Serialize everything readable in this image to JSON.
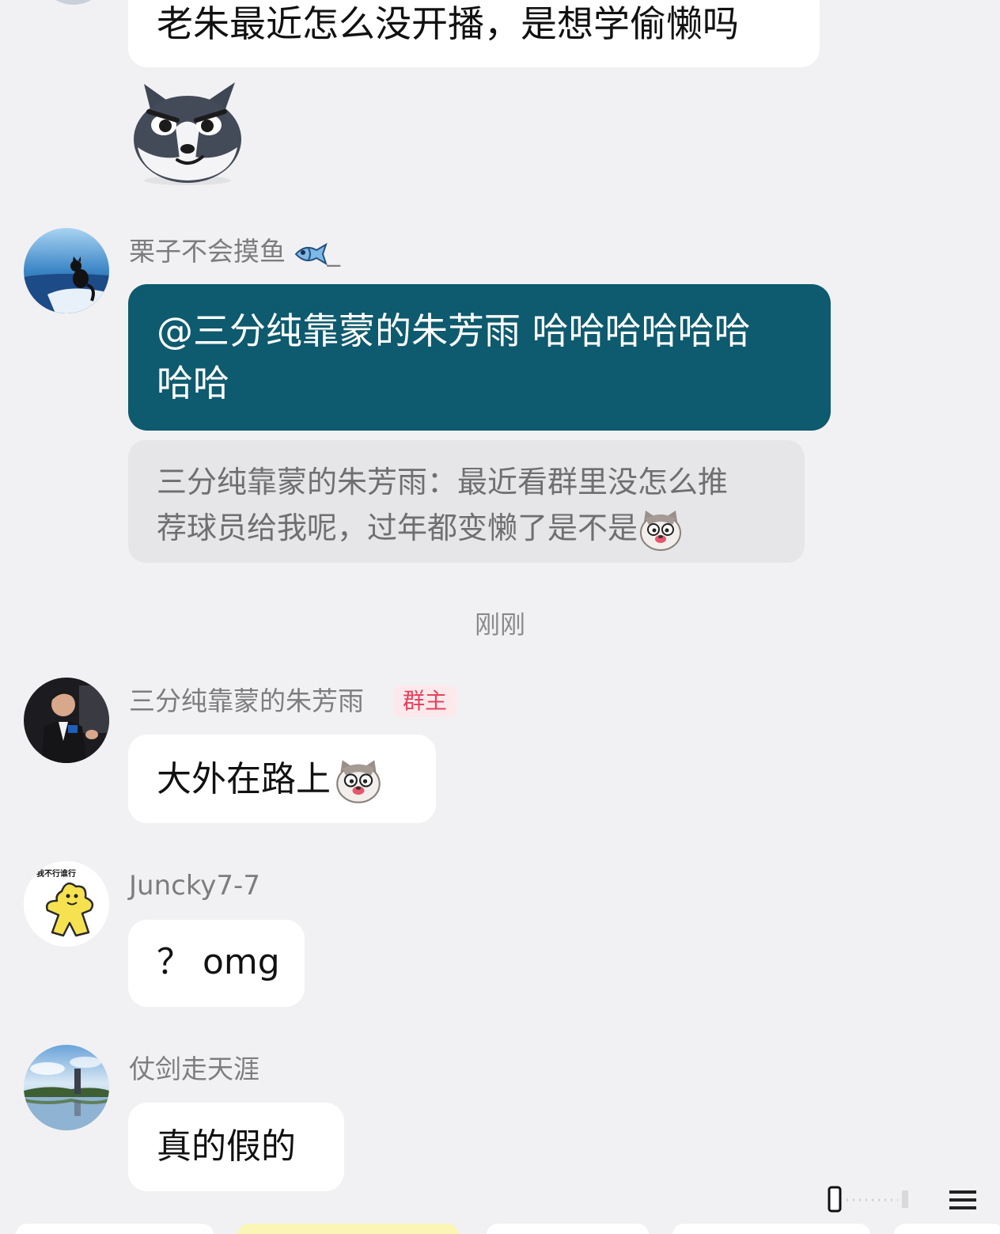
{
  "messages": {
    "m1": {
      "text": "老朱最近怎么没开播，是想学偷懒吗"
    },
    "m2": {
      "nickname": "栗子不会摸鱼",
      "nickname_suffix": "_",
      "mention": "@三分纯靠蒙的朱芳雨",
      "text_line1": "哈哈哈哈哈哈",
      "text_line2": "哈哈",
      "quote_line1": "三分纯靠蒙的朱芳雨：最近看群里没怎么推",
      "quote_line2": "荐球员给我呢，过年都变懒了是不是"
    },
    "timestamp": "刚刚",
    "m3": {
      "nickname": "三分纯靠蒙的朱芳雨",
      "badge": "群主",
      "text": "大外在路上"
    },
    "m4": {
      "nickname": "Juncky7-7",
      "avatar_caption": "我不行谁行",
      "text": "？ omg"
    },
    "m5": {
      "nickname": "仗剑走天涯",
      "text": "真的假的"
    }
  },
  "colors": {
    "background": "#f1f1f3",
    "highlight_bubble": "#0e5a6e",
    "owner_badge": "#e4425e"
  },
  "icons": [
    "husky-sticker",
    "fish-icon",
    "cat-face-emoji",
    "cat-face-emoji",
    "scroll-indicator-icon"
  ]
}
